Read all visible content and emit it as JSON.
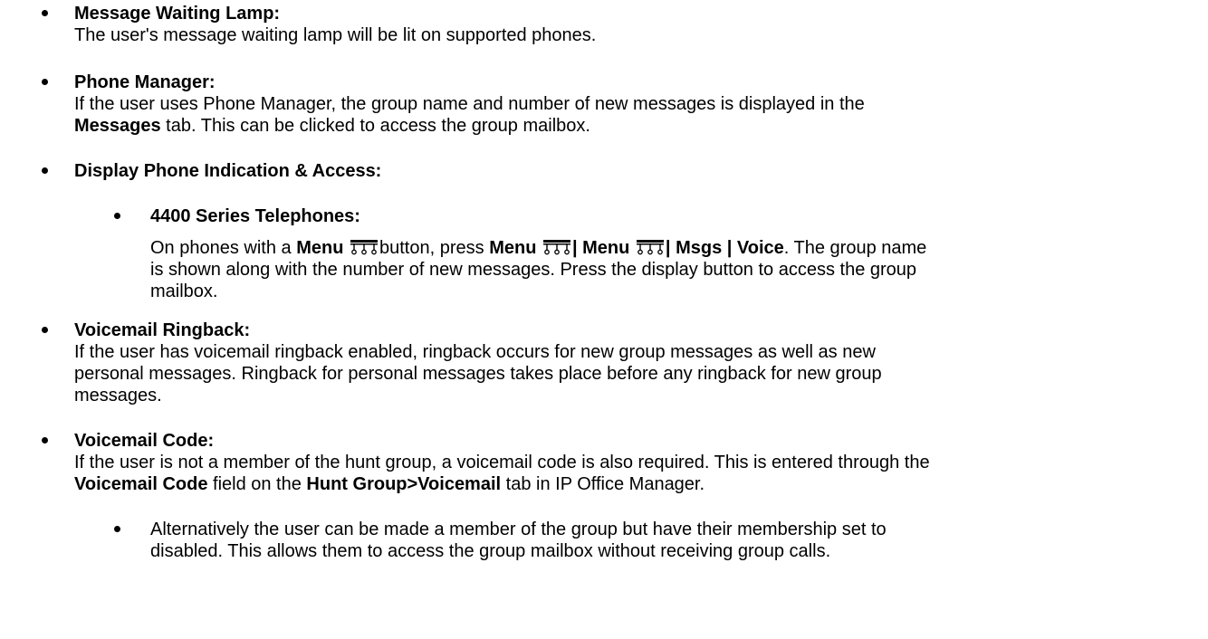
{
  "items": [
    {
      "title": "Message Waiting Lamp:",
      "line1": "The user's message waiting lamp will be lit on supported phones."
    },
    {
      "title": "Phone Manager:",
      "line1": "If the user uses Phone Manager, the group name and number of new messages is displayed in the",
      "line2_bold": "Messages",
      "line2_rest": " tab. This can be clicked to access the group  mailbox."
    },
    {
      "title": "Display Phone Indication & Access:",
      "sub": {
        "title": "4400 Series Telephones:",
        "l1_a": "On phones with a ",
        "l1_menu": "Menu",
        "l1_b": "button, press ",
        "l1_menu2": "Menu",
        "l1_sep1": "| ",
        "l1_menu3": "Menu",
        "l1_sep2": "| ",
        "l1_msgs": "Msgs | Voice",
        "l1_c": ". The group name",
        "l2": "is shown along with the number of new messages. Press the display button to access the group",
        "l3": "mailbox."
      }
    },
    {
      "title": "Voicemail Ringback:",
      "line1": "If the user has voicemail ringback enabled, ringback occurs for new group messages as well as new",
      "line2": "personal messages. Ringback for personal messages takes place before any ringback for new group",
      "line3": "messages."
    },
    {
      "title": "Voicemail Code:",
      "line1": "If the user is not a member of the hunt group, a voicemail code is also required. This is entered through the",
      "line2_bold1": "Voicemail Code",
      "line2_mid": " field on the ",
      "line2_bold2": "Hunt Group>Voicemail",
      "line2_end": " tab in IP Office Manager.",
      "sub": {
        "line1": "Alternatively the user can be made a member of the group but have their membership set to",
        "line2": "disabled. This allows them to access the group mailbox without receiving group calls."
      }
    }
  ],
  "icons": {
    "menu": "menu-key-icon"
  }
}
